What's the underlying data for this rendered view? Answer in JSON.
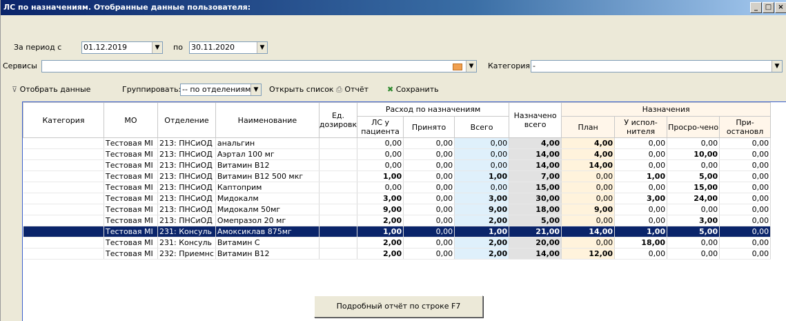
{
  "window": {
    "title": "ЛС по назначениям. Отобранные данные пользователя:",
    "btn_min": "_",
    "btn_max": "□",
    "btn_close": "×"
  },
  "filters": {
    "period_label": "За период с",
    "date_from": "01.12.2019",
    "to_label": "по",
    "date_to": "30.11.2020",
    "services_label": "Сервисы",
    "services_value": "",
    "category_label": "Категория",
    "category_value": "-"
  },
  "toolbar": {
    "filter_btn": "Отобрать данные",
    "group_label": "Группировать:",
    "group_value": "-- по отделениям --",
    "open_list": "Открыть список",
    "report": "Отчёт",
    "save": "Сохранить"
  },
  "table": {
    "headers": {
      "category": "Категория",
      "mo": "МО",
      "dept": "Отделение",
      "name": "Наименование",
      "unit": "Ед. дозировк",
      "group1": "Расход по назначениям",
      "ls": "ЛС у пациента",
      "accepted": "Принято",
      "total": "Всего",
      "assigned": "Назначено всего",
      "group2": "Назначения",
      "plan": "План",
      "exec": "У испол-нителя",
      "overdue": "Просро-чено",
      "paused": "При-остановл"
    },
    "rows": [
      {
        "category": "",
        "mo": "Тестовая МІ",
        "dept": "213: ПНСиОД",
        "name": "анальгин",
        "unit": "",
        "ls": "0,00",
        "acc": "0,00",
        "tot": "0,00",
        "asg": "4,00",
        "plan": "4,00",
        "exec": "0,00",
        "over": "0,00",
        "pause": "0,00"
      },
      {
        "category": "",
        "mo": "Тестовая МІ",
        "dept": "213: ПНСиОД",
        "name": "Аэртал 100 мг",
        "unit": "",
        "ls": "0,00",
        "acc": "0,00",
        "tot": "0,00",
        "asg": "14,00",
        "plan": "4,00",
        "exec": "0,00",
        "over": "10,00",
        "pause": "0,00"
      },
      {
        "category": "",
        "mo": "Тестовая МІ",
        "dept": "213: ПНСиОД",
        "name": "Витамин В12",
        "unit": "",
        "ls": "0,00",
        "acc": "0,00",
        "tot": "0,00",
        "asg": "14,00",
        "plan": "14,00",
        "exec": "0,00",
        "over": "0,00",
        "pause": "0,00"
      },
      {
        "category": "",
        "mo": "Тестовая МІ",
        "dept": "213: ПНСиОД",
        "name": "Витамин В12 500 мкг",
        "unit": "",
        "ls": "1,00",
        "acc": "0,00",
        "tot": "1,00",
        "asg": "7,00",
        "plan": "0,00",
        "exec": "1,00",
        "over": "5,00",
        "pause": "0,00"
      },
      {
        "category": "",
        "mo": "Тестовая МІ",
        "dept": "213: ПНСиОД",
        "name": "Каптоприм",
        "unit": "",
        "ls": "0,00",
        "acc": "0,00",
        "tot": "0,00",
        "asg": "15,00",
        "plan": "0,00",
        "exec": "0,00",
        "over": "15,00",
        "pause": "0,00"
      },
      {
        "category": "",
        "mo": "Тестовая МІ",
        "dept": "213: ПНСиОД",
        "name": "Мидокалм",
        "unit": "",
        "ls": "3,00",
        "acc": "0,00",
        "tot": "3,00",
        "asg": "30,00",
        "plan": "0,00",
        "exec": "3,00",
        "over": "24,00",
        "pause": "0,00"
      },
      {
        "category": "",
        "mo": "Тестовая МІ",
        "dept": "213: ПНСиОД",
        "name": "Мидокалм 50мг",
        "unit": "",
        "ls": "9,00",
        "acc": "0,00",
        "tot": "9,00",
        "asg": "18,00",
        "plan": "9,00",
        "exec": "0,00",
        "over": "0,00",
        "pause": "0,00"
      },
      {
        "category": "",
        "mo": "Тестовая МІ",
        "dept": "213: ПНСиОД",
        "name": "Омепразол 20 мг",
        "unit": "",
        "ls": "2,00",
        "acc": "0,00",
        "tot": "2,00",
        "asg": "5,00",
        "plan": "0,00",
        "exec": "0,00",
        "over": "3,00",
        "pause": "0,00"
      },
      {
        "category": "",
        "mo": "Тестовая МІ",
        "dept": "231: Консуль",
        "name": "Амоксиклав 875мг",
        "unit": "",
        "ls": "1,00",
        "acc": "0,00",
        "tot": "1,00",
        "asg": "21,00",
        "plan": "14,00",
        "exec": "1,00",
        "over": "5,00",
        "pause": "0,00",
        "selected": true
      },
      {
        "category": "",
        "mo": "Тестовая МІ",
        "dept": "231: Консуль",
        "name": "Витамин С",
        "unit": "",
        "ls": "2,00",
        "acc": "0,00",
        "tot": "2,00",
        "asg": "20,00",
        "plan": "0,00",
        "exec": "18,00",
        "over": "0,00",
        "pause": "0,00"
      },
      {
        "category": "",
        "mo": "Тестовая МІ",
        "dept": "232: Приемнс",
        "name": "Витамин В12",
        "unit": "",
        "ls": "2,00",
        "acc": "0,00",
        "tot": "2,00",
        "asg": "14,00",
        "plan": "12,00",
        "exec": "0,00",
        "over": "0,00",
        "pause": "0,00"
      }
    ]
  },
  "detail_button": "Подробный отчёт по строке   F7"
}
